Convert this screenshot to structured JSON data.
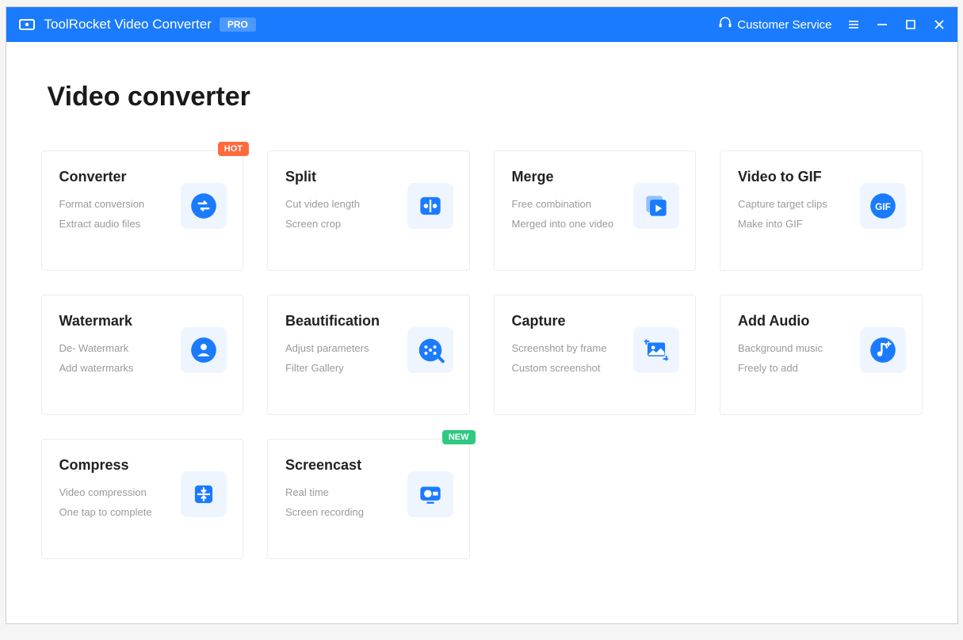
{
  "header": {
    "app_title": "ToolRocket Video Converter",
    "pro_badge": "PRO",
    "customer_service": "Customer Service"
  },
  "page": {
    "title": "Video converter"
  },
  "badges": {
    "hot": "HOT",
    "new": "NEW"
  },
  "cards": [
    {
      "id": "converter",
      "title": "Converter",
      "line1": "Format conversion",
      "line2": "Extract audio files",
      "badge": "hot",
      "icon": "converter-icon"
    },
    {
      "id": "split",
      "title": "Split",
      "line1": "Cut video length",
      "line2": "Screen crop",
      "badge": null,
      "icon": "split-icon"
    },
    {
      "id": "merge",
      "title": "Merge",
      "line1": "Free combination",
      "line2": "Merged into one video",
      "badge": null,
      "icon": "merge-icon"
    },
    {
      "id": "video-to-gif",
      "title": "Video to GIF",
      "line1": "Capture target clips",
      "line2": "Make into GIF",
      "badge": null,
      "icon": "gif-icon"
    },
    {
      "id": "watermark",
      "title": "Watermark",
      "line1": "De- Watermark",
      "line2": "Add watermarks",
      "badge": null,
      "icon": "watermark-icon"
    },
    {
      "id": "beautification",
      "title": "Beautification",
      "line1": "Adjust parameters",
      "line2": "Filter Gallery",
      "badge": null,
      "icon": "beautification-icon"
    },
    {
      "id": "capture",
      "title": "Capture",
      "line1": "Screenshot by frame",
      "line2": "Custom screenshot",
      "badge": null,
      "icon": "capture-icon"
    },
    {
      "id": "add-audio",
      "title": "Add Audio",
      "line1": "Background music",
      "line2": "Freely to add",
      "badge": null,
      "icon": "audio-icon"
    },
    {
      "id": "compress",
      "title": "Compress",
      "line1": "Video compression",
      "line2": "One tap to complete",
      "badge": null,
      "icon": "compress-icon"
    },
    {
      "id": "screencast",
      "title": "Screencast",
      "line1": "Real time",
      "line2": "Screen recording",
      "badge": "new",
      "icon": "screencast-icon"
    }
  ],
  "colors": {
    "accent": "#1a7bff",
    "card_icon_bg": "#eef5ff",
    "badge_hot": "#ff6a3d",
    "badge_new": "#2fc981"
  }
}
